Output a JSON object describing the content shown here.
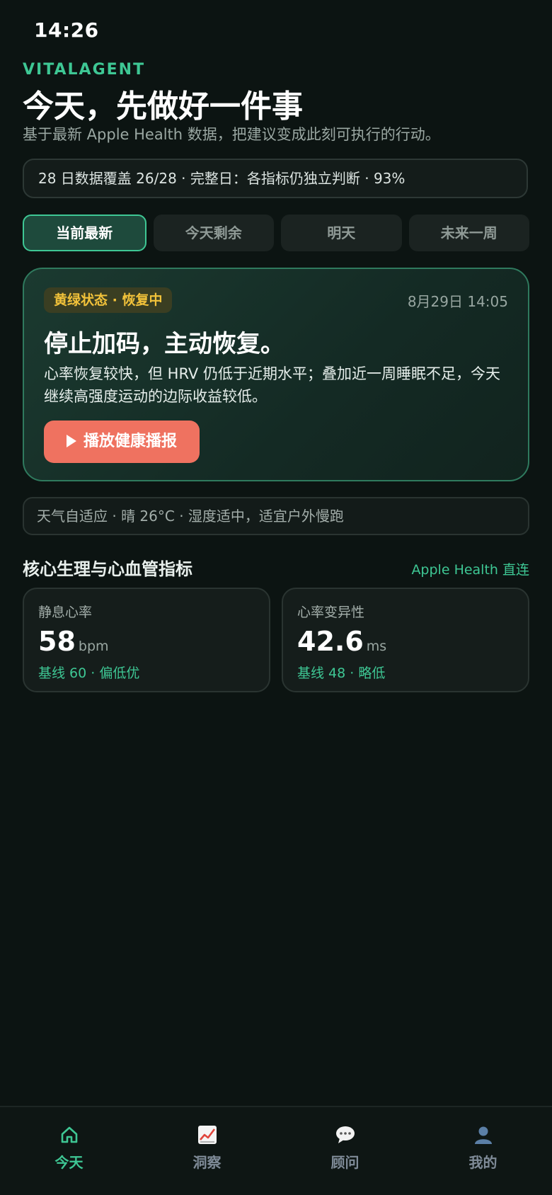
{
  "status_bar": {
    "time": "14:26"
  },
  "header": {
    "brand": "VITALAGENT",
    "title": "今天，先做好一件事",
    "subtitle": "基于最新 Apple Health 数据，把建议变成此刻可执行的行动。"
  },
  "coverage": {
    "text": "28 日数据覆盖 26/28 · 完整日：各指标仍独立判断 · 93%"
  },
  "tabs": [
    {
      "label": "当前最新",
      "active": true
    },
    {
      "label": "今天剩余",
      "active": false
    },
    {
      "label": "明天",
      "active": false
    },
    {
      "label": "未来一周",
      "active": false
    }
  ],
  "hero": {
    "badge": "黄绿状态 · 恢复中",
    "timestamp": "8月29日 14:05",
    "title": "停止加码，主动恢复。",
    "body": "心率恢复较快，但 HRV 仍低于近期水平；叠加近一周睡眠不足，今天继续高强度运动的边际收益较低。",
    "button_label": "播放健康播报"
  },
  "weather": {
    "text": "天气自适应 · 晴 26°C · 湿度适中，适宜户外慢跑"
  },
  "metrics_section": {
    "title": "核心生理与心血管指标",
    "link": "Apple Health 直连",
    "cards": [
      {
        "label": "静息心率",
        "value": "58",
        "unit": "bpm",
        "note": "基线 60 · 偏低优"
      },
      {
        "label": "心率变异性",
        "value": "42.6",
        "unit": "ms",
        "note": "基线 48 · 略低"
      }
    ]
  },
  "bottom_nav": [
    {
      "label": "今天",
      "icon": "home-icon",
      "active": true
    },
    {
      "label": "洞察",
      "icon": "chart-icon",
      "active": false
    },
    {
      "label": "顾问",
      "icon": "chat-icon",
      "active": false
    },
    {
      "label": "我的",
      "icon": "profile-icon",
      "active": false
    }
  ],
  "colors": {
    "accent": "#3ec794",
    "background": "#0c1412",
    "badge_text": "#f2c23a",
    "button": "#ef7260"
  }
}
